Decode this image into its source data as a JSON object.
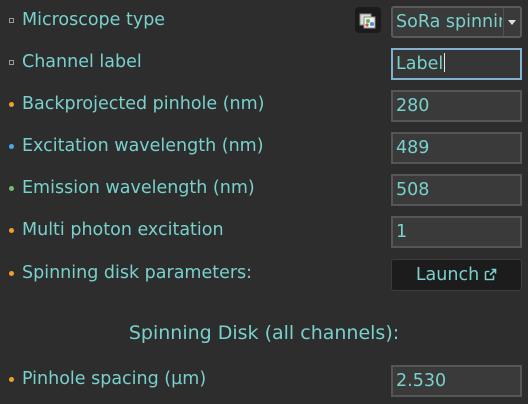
{
  "colors": {
    "label": "#78d1cc",
    "background": "#2d2d2d",
    "bullet_gray": "#9a9a9a",
    "bullet_orange": "#f0a030",
    "bullet_blue": "#4aa8e8",
    "bullet_green": "#6fc070"
  },
  "fields": {
    "microscope_type": {
      "label": "Microscope type",
      "value": "SoRa spinnin"
    },
    "channel_label": {
      "label": "Channel label",
      "value": "Label"
    },
    "backprojected_pinhole": {
      "label": "Backprojected pinhole (nm)",
      "value": "280"
    },
    "excitation_wavelength": {
      "label": "Excitation wavelength (nm)",
      "value": "489"
    },
    "emission_wavelength": {
      "label": "Emission wavelength (nm)",
      "value": "508"
    },
    "multi_photon": {
      "label": "Multi photon excitation",
      "value": "1"
    },
    "spinning_disk_params": {
      "label": "Spinning disk parameters:",
      "button": "Launch"
    },
    "pinhole_spacing": {
      "label": "Pinhole spacing (µm)",
      "value": "2.530"
    }
  },
  "section": {
    "title": "Spinning Disk (all channels):"
  },
  "icons": {
    "copy": "copy-to-channels-icon",
    "external": "external-link-icon"
  }
}
